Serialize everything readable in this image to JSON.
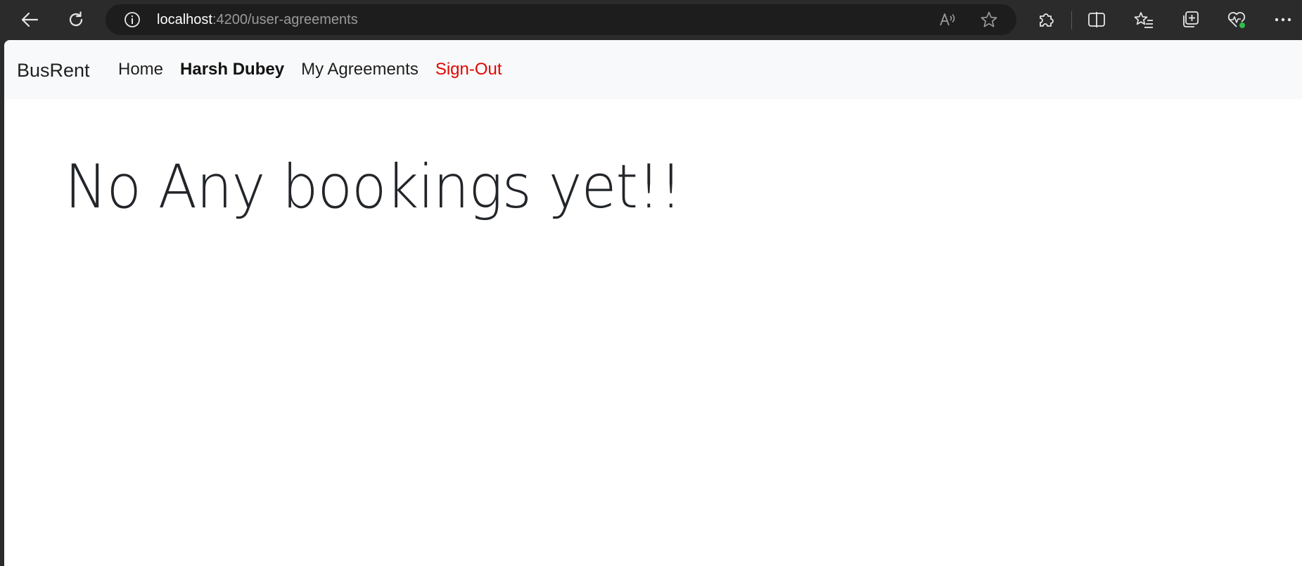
{
  "browser": {
    "url_host": "localhost",
    "url_path": ":4200/user-agreements",
    "icons": {
      "back": "back-arrow-icon",
      "refresh": "refresh-icon",
      "site_info": "info-icon",
      "read_aloud": "read-aloud-icon",
      "favorite": "star-icon",
      "extensions": "puzzle-icon",
      "split_screen": "split-screen-icon",
      "favorites": "favorites-list-icon",
      "collections": "collections-icon",
      "health": "heartbeat-icon",
      "more": "ellipsis-icon"
    }
  },
  "navbar": {
    "brand": "BusRent",
    "items": [
      {
        "label": "Home",
        "style": "normal"
      },
      {
        "label": "Harsh Dubey",
        "style": "bold"
      },
      {
        "label": "My Agreements",
        "style": "normal"
      },
      {
        "label": "Sign-Out",
        "style": "red"
      }
    ],
    "signout_color": "#e10600"
  },
  "main": {
    "headline": "No Any bookings yet!!"
  }
}
